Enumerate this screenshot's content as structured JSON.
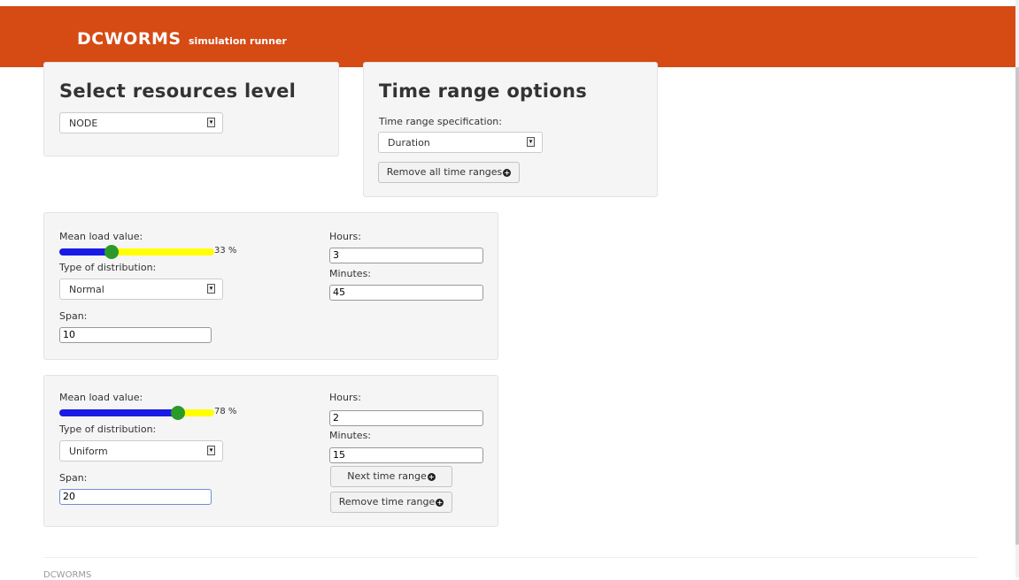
{
  "navbar": {
    "brand": "DCWORMS",
    "subtitle": "simulation runner",
    "color": "#d64a14"
  },
  "resources": {
    "title": "Select resources level",
    "level": "NODE"
  },
  "time_options": {
    "title": "Time range options",
    "spec_label": "Time range specification:",
    "spec_value": "Duration",
    "remove_all_label": "Remove all time ranges"
  },
  "ranges": [
    {
      "mean_label": "Mean load value:",
      "mean_value": 33,
      "mean_text": "33 %",
      "dist_label": "Type of distribution:",
      "dist_value": "Normal",
      "span_label": "Span:",
      "span_value": "10",
      "hours_label": "Hours:",
      "hours_value": "3",
      "minutes_label": "Minutes:",
      "minutes_value": "45"
    },
    {
      "mean_label": "Mean load value:",
      "mean_value": 78,
      "mean_text": "78 %",
      "dist_label": "Type of distribution:",
      "dist_value": "Uniform",
      "span_label": "Span:",
      "span_value": "20",
      "hours_label": "Hours:",
      "hours_value": "2",
      "minutes_label": "Minutes:",
      "minutes_value": "15",
      "next_label": "Next time range",
      "remove_label": "Remove time range"
    }
  ],
  "footer": {
    "text": "DCWORMS"
  },
  "icons": {
    "plus": "plus-circle-icon",
    "dropdown": "dropdown-arrow-icon"
  }
}
